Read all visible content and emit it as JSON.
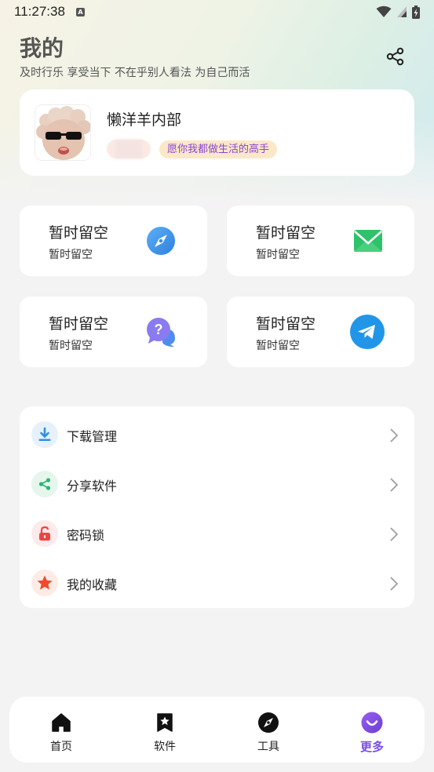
{
  "status_bar": {
    "time": "11:27:38",
    "notification_icon": "A"
  },
  "header": {
    "title": "我的",
    "subtitle": "及时行乐 享受当下 不在乎别人看法 为自己而活"
  },
  "profile": {
    "name": "懒洋羊内部",
    "motto": "愿你我都做生活的高手"
  },
  "grid_cards": [
    {
      "title": "暂时留空",
      "subtitle": "暂时留空",
      "icon": "compass-icon",
      "color": "#3a8ee6"
    },
    {
      "title": "暂时留空",
      "subtitle": "暂时留空",
      "icon": "mail-icon",
      "color": "#2ec26b"
    },
    {
      "title": "暂时留空",
      "subtitle": "暂时留空",
      "icon": "question-chat-icon",
      "color": "#7b72e8"
    },
    {
      "title": "暂时留空",
      "subtitle": "暂时留空",
      "icon": "telegram-icon",
      "color": "#2196e8"
    }
  ],
  "menu": [
    {
      "label": "下载管理",
      "icon": "download-icon",
      "color": "#2f8fe6"
    },
    {
      "label": "分享软件",
      "icon": "share-icon",
      "color": "#2bb673"
    },
    {
      "label": "密码锁",
      "icon": "lock-icon",
      "color": "#ef4444"
    },
    {
      "label": "我的收藏",
      "icon": "star-icon",
      "color": "#ef4a2d"
    }
  ],
  "bottom_nav": [
    {
      "label": "首页",
      "icon": "home-icon",
      "active": false
    },
    {
      "label": "软件",
      "icon": "bookmark-star-icon",
      "active": false
    },
    {
      "label": "工具",
      "icon": "compass-icon",
      "active": false
    },
    {
      "label": "更多",
      "icon": "smile-icon",
      "active": true
    }
  ],
  "colors": {
    "accent": "#7a4fe0",
    "motto_bg": "#fbe8c8",
    "motto_text": "#8a44d6"
  }
}
